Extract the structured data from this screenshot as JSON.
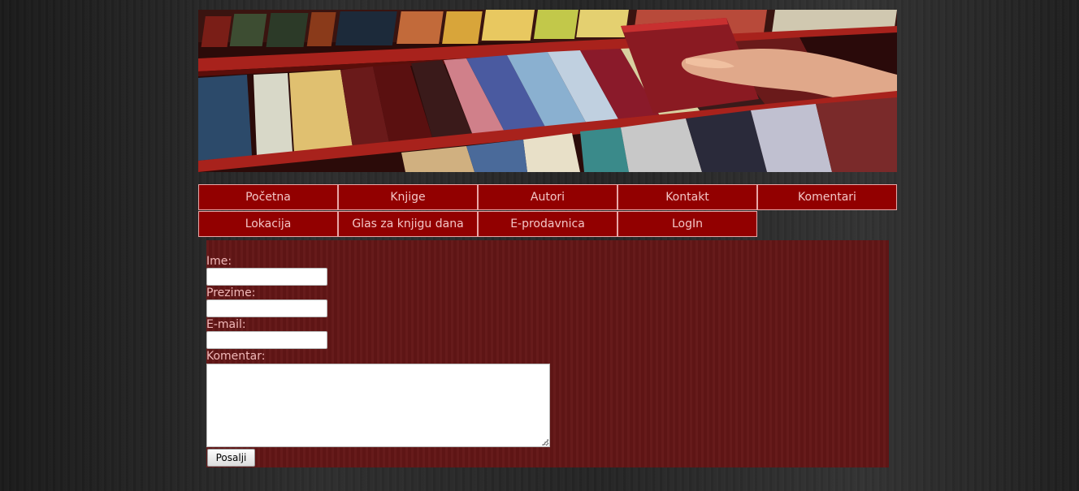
{
  "banner": {
    "image": "library-bookshelf-photo"
  },
  "nav": {
    "items": [
      {
        "label": "Početna"
      },
      {
        "label": "Knjige"
      },
      {
        "label": "Autori"
      },
      {
        "label": "Kontakt"
      },
      {
        "label": "Komentari"
      },
      {
        "label": "Lokacija"
      },
      {
        "label": "Glas za knjigu dana"
      },
      {
        "label": "E-prodavnica"
      },
      {
        "label": "LogIn"
      }
    ]
  },
  "form": {
    "name_label": "Ime:",
    "name_value": "",
    "surname_label": "Prezime:",
    "surname_value": "",
    "email_label": "E-mail:",
    "email_value": "",
    "comment_label": "Komentar:",
    "comment_value": "",
    "submit_label": "Posalji"
  },
  "colors": {
    "nav_background": "#920000",
    "nav_border": "#e8a7a7",
    "content_background": "#621616",
    "label_text": "#f1b9b9"
  }
}
